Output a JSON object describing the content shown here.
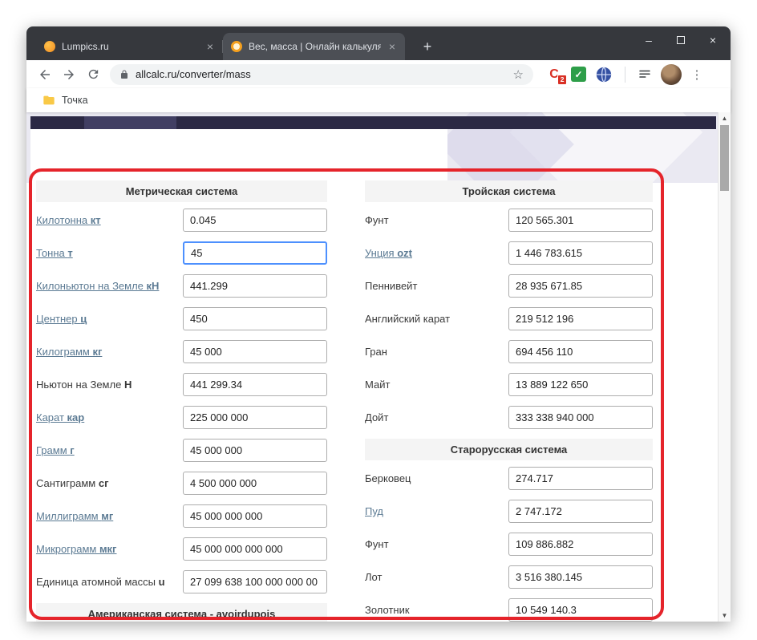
{
  "icons": {
    "minimize": "–",
    "close": "×",
    "tab_close": "×",
    "new_tab": "+",
    "star": "☆",
    "check": "✓",
    "kebab": "⋮",
    "scroll_up": "▲",
    "scroll_down": "▼"
  },
  "browser": {
    "tabs": [
      {
        "title": "Lumpics.ru",
        "active": false
      },
      {
        "title": "Вес, масса | Онлайн калькулято",
        "active": true
      }
    ],
    "url": "allcalc.ru/converter/mass",
    "extension_letter": "C",
    "extension_badge": "2",
    "bookmark_label": "Точка"
  },
  "converter": {
    "columns": [
      {
        "sections": [
          {
            "title": "Метрическая система",
            "rows": [
              {
                "label": "Килотонна",
                "unit": "кт",
                "link": true,
                "value": "0.045"
              },
              {
                "label": "Тонна",
                "unit": "т",
                "link": true,
                "value": "45",
                "focused": true
              },
              {
                "label": "Килоньютон на Земле",
                "unit": "кН",
                "link": true,
                "value": "441.299"
              },
              {
                "label": "Центнер",
                "unit": "ц",
                "link": true,
                "value": "450"
              },
              {
                "label": "Килограмм",
                "unit": "кг",
                "link": true,
                "value": "45 000"
              },
              {
                "label": "Ньютон на Земле",
                "unit": "Н",
                "link": false,
                "value": "441 299.34"
              },
              {
                "label": "Карат",
                "unit": "кар",
                "link": true,
                "value": "225 000 000"
              },
              {
                "label": "Грамм",
                "unit": "г",
                "link": true,
                "value": "45 000 000"
              },
              {
                "label": "Сантиграмм",
                "unit": "сг",
                "link": false,
                "value": "4 500 000 000"
              },
              {
                "label": "Миллиграмм",
                "unit": "мг",
                "link": true,
                "value": "45 000 000 000"
              },
              {
                "label": "Микрограмм",
                "unit": "мкг",
                "link": true,
                "value": "45 000 000 000 000"
              },
              {
                "label": "Единица атомной массы",
                "unit": "u",
                "link": false,
                "value": "27 099 638 100 000 000 00"
              }
            ]
          },
          {
            "title": "Американская система - avoirdupois",
            "rows": []
          }
        ]
      },
      {
        "sections": [
          {
            "title": "Тройская система",
            "rows": [
              {
                "label": "Фунт",
                "unit": "",
                "link": false,
                "value": "120 565.301"
              },
              {
                "label": "Унция",
                "unit": "ozt",
                "link": true,
                "value": "1 446 783.615"
              },
              {
                "label": "Пеннивейт",
                "unit": "",
                "link": false,
                "value": "28 935 671.85"
              },
              {
                "label": "Английский карат",
                "unit": "",
                "link": false,
                "value": "219 512 196"
              },
              {
                "label": "Гран",
                "unit": "",
                "link": false,
                "value": "694 456 110"
              },
              {
                "label": "Майт",
                "unit": "",
                "link": false,
                "value": "13 889 122 650"
              },
              {
                "label": "Дойт",
                "unit": "",
                "link": false,
                "value": "333 338 940 000"
              }
            ]
          },
          {
            "title": "Старорусская система",
            "rows": [
              {
                "label": "Берковец",
                "unit": "",
                "link": false,
                "value": "274.717"
              },
              {
                "label": "Пуд",
                "unit": "",
                "link": true,
                "value": "2 747.172"
              },
              {
                "label": "Фунт",
                "unit": "",
                "link": false,
                "value": "109 886.882"
              },
              {
                "label": "Лот",
                "unit": "",
                "link": false,
                "value": "3 516 380.145"
              },
              {
                "label": "Золотник",
                "unit": "",
                "link": false,
                "value": "10 549 140.3"
              }
            ]
          }
        ]
      }
    ]
  }
}
